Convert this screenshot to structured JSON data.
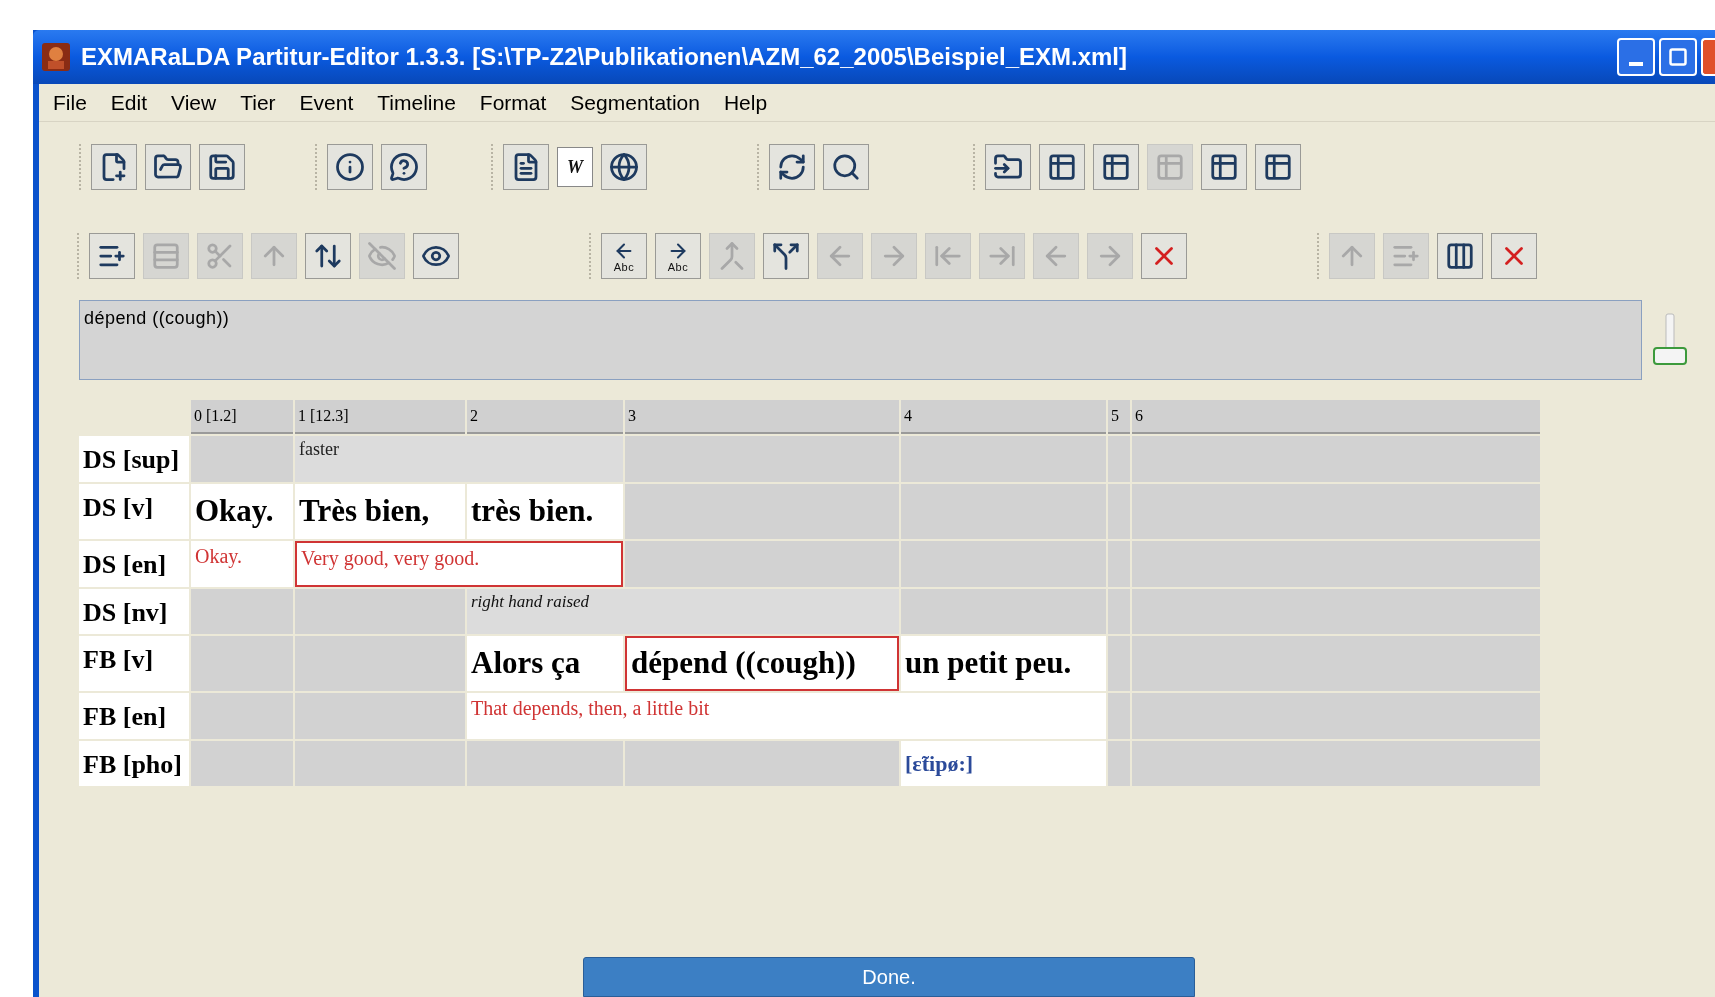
{
  "window": {
    "title": "EXMARaLDA Partitur-Editor 1.3.3. [S:\\TP-Z2\\Publikationen\\AZM_62_2005\\Beispiel_EXM.xml]"
  },
  "menu": [
    "File",
    "Edit",
    "View",
    "Tier",
    "Event",
    "Timeline",
    "Format",
    "Segmentation",
    "Help"
  ],
  "toolbars": [
    {
      "groups": [
        {
          "buttons": [
            {
              "kind": "new-file",
              "disabled": false
            },
            {
              "kind": "open",
              "disabled": false
            },
            {
              "kind": "save",
              "disabled": false
            }
          ]
        },
        {
          "buttons": [
            {
              "kind": "info",
              "disabled": false
            },
            {
              "kind": "help",
              "disabled": false
            }
          ]
        },
        {
          "buttons": [
            {
              "kind": "document",
              "disabled": false
            },
            {
              "kind": "letter",
              "text": "W",
              "disabled": false
            },
            {
              "kind": "globe",
              "disabled": false
            }
          ]
        },
        {
          "buttons": [
            {
              "kind": "refresh",
              "disabled": false
            },
            {
              "kind": "search",
              "disabled": false
            }
          ]
        },
        {
          "buttons": [
            {
              "kind": "table-open",
              "disabled": false
            },
            {
              "kind": "table-save",
              "disabled": false
            },
            {
              "kind": "table",
              "disabled": false
            },
            {
              "kind": "table",
              "disabled": true
            },
            {
              "kind": "table",
              "disabled": false
            },
            {
              "kind": "table",
              "disabled": false
            }
          ]
        }
      ]
    },
    {
      "groups": [
        {
          "buttons": [
            {
              "kind": "tier-add",
              "disabled": false
            },
            {
              "kind": "tier-edit",
              "disabled": true
            },
            {
              "kind": "tier-delete",
              "disabled": true
            },
            {
              "kind": "tier-up",
              "disabled": true
            },
            {
              "kind": "tier-swap",
              "disabled": false
            },
            {
              "kind": "tier-hide",
              "disabled": true
            },
            {
              "kind": "tier-view",
              "disabled": false
            }
          ]
        },
        {
          "buttons": [
            {
              "kind": "abc-left",
              "text": "Abc",
              "disabled": false
            },
            {
              "kind": "abc-right",
              "text": "Abc",
              "disabled": false
            },
            {
              "kind": "merge",
              "disabled": true
            },
            {
              "kind": "split",
              "disabled": false
            },
            {
              "kind": "move-left",
              "disabled": true
            },
            {
              "kind": "move-right",
              "disabled": true
            },
            {
              "kind": "shift-left",
              "disabled": true
            },
            {
              "kind": "shift-right",
              "disabled": true
            },
            {
              "kind": "move-left",
              "disabled": true
            },
            {
              "kind": "move-right",
              "disabled": true
            },
            {
              "kind": "delete",
              "disabled": false
            }
          ]
        },
        {
          "buttons": [
            {
              "kind": "tier-up",
              "disabled": true
            },
            {
              "kind": "tier-add",
              "disabled": true
            },
            {
              "kind": "columns",
              "disabled": false
            },
            {
              "kind": "delete",
              "disabled": false
            }
          ]
        }
      ]
    }
  ],
  "event_field": {
    "value": "dépend ((cough))"
  },
  "timeline": [
    "0 [1.2]",
    "1 [12.3]",
    "2",
    "3",
    "4",
    "5",
    "6"
  ],
  "tiers": [
    {
      "label": "DS [sup]",
      "kind": "supplementary",
      "cells": [
        {
          "kind": "empty"
        },
        {
          "kind": "event",
          "text": "faster",
          "highlighted": false
        },
        {
          "kind": "continued"
        },
        {
          "kind": "empty"
        },
        {
          "kind": "empty"
        },
        {
          "kind": "empty"
        },
        {
          "kind": "empty"
        }
      ]
    },
    {
      "label": "DS [v]",
      "kind": "verbal",
      "cells": [
        {
          "kind": "event",
          "text": "Okay.",
          "highlighted": false
        },
        {
          "kind": "event",
          "text": "Très bien,",
          "highlighted": false
        },
        {
          "kind": "event",
          "text": "très bien.",
          "highlighted": false
        },
        {
          "kind": "empty"
        },
        {
          "kind": "empty"
        },
        {
          "kind": "empty"
        },
        {
          "kind": "empty"
        }
      ]
    },
    {
      "label": "DS [en]",
      "kind": "translation",
      "cells": [
        {
          "kind": "event",
          "text": "Okay.",
          "highlighted": false
        },
        {
          "kind": "event",
          "text": "Very good, very good.",
          "highlighted": true
        },
        {
          "kind": "continued"
        },
        {
          "kind": "empty"
        },
        {
          "kind": "empty"
        },
        {
          "kind": "empty"
        },
        {
          "kind": "empty"
        }
      ]
    },
    {
      "label": "DS [nv]",
      "kind": "nonverbal",
      "cells": [
        {
          "kind": "empty"
        },
        {
          "kind": "empty"
        },
        {
          "kind": "event",
          "text": "right hand raised",
          "highlighted": false
        },
        {
          "kind": "continued"
        },
        {
          "kind": "empty"
        },
        {
          "kind": "empty"
        },
        {
          "kind": "empty"
        }
      ]
    },
    {
      "label": "FB [v]",
      "kind": "verbal",
      "cells": [
        {
          "kind": "empty"
        },
        {
          "kind": "empty"
        },
        {
          "kind": "event",
          "text": "Alors ça",
          "highlighted": false
        },
        {
          "kind": "event",
          "text": "dépend ((cough))",
          "highlighted": true
        },
        {
          "kind": "event",
          "text": "un petit peu.",
          "highlighted": false
        },
        {
          "kind": "empty"
        },
        {
          "kind": "empty"
        }
      ]
    },
    {
      "label": "FB [en]",
      "kind": "translation",
      "cells": [
        {
          "kind": "empty"
        },
        {
          "kind": "empty"
        },
        {
          "kind": "event",
          "text": "That depends, then, a little bit",
          "highlighted": false
        },
        {
          "kind": "continued"
        },
        {
          "kind": "continued"
        },
        {
          "kind": "empty"
        },
        {
          "kind": "empty"
        }
      ]
    },
    {
      "label": "FB [pho]",
      "kind": "phonetic",
      "cells": [
        {
          "kind": "empty"
        },
        {
          "kind": "empty"
        },
        {
          "kind": "empty"
        },
        {
          "kind": "empty"
        },
        {
          "kind": "event",
          "text": "[ɛ̃tipø:]",
          "highlighted": false
        },
        {
          "kind": "empty"
        },
        {
          "kind": "empty"
        }
      ]
    }
  ],
  "done_button": {
    "label": "Done."
  }
}
